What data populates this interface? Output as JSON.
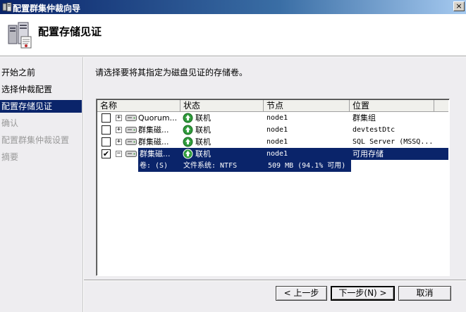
{
  "window": {
    "title": "配置群集仲裁向导",
    "close_label": "×"
  },
  "header": {
    "title": "配置存储见证"
  },
  "nav": {
    "items": [
      {
        "label": "开始之前",
        "state": "done"
      },
      {
        "label": "选择仲裁配置",
        "state": "done"
      },
      {
        "label": "配置存储见证",
        "state": "active"
      },
      {
        "label": "确认",
        "state": "pending"
      },
      {
        "label": "配置群集仲裁设置",
        "state": "pending"
      },
      {
        "label": "摘要",
        "state": "pending"
      }
    ]
  },
  "main": {
    "instruction": "请选择要将其指定为磁盘见证的存储卷。",
    "columns": [
      "名称",
      "状态",
      "节点",
      "位置"
    ],
    "rows": [
      {
        "checked": false,
        "expander": "+",
        "name": "Quorum...",
        "status": "联机",
        "node": "node1",
        "location": "群集组"
      },
      {
        "checked": false,
        "expander": "+",
        "name": "群集磁...",
        "status": "联机",
        "node": "node1",
        "location": "devtestDtc"
      },
      {
        "checked": false,
        "expander": "+",
        "name": "群集磁...",
        "status": "联机",
        "node": "node1",
        "location": "SQL Server (MSSQ..."
      },
      {
        "checked": true,
        "expander": "−",
        "name": "群集磁...",
        "status": "联机",
        "node": "node1",
        "location": "可用存储"
      }
    ],
    "detail": {
      "volume": "卷: (S)",
      "filesystem": "文件系统: NTFS",
      "size": "509 MB (94.1% 可用)"
    }
  },
  "buttons": {
    "back": "< 上一步",
    "next": "下一步(N) >",
    "cancel": "取消"
  },
  "colors": {
    "selection": "#0a246a",
    "online_icon": "#2e9b3a"
  }
}
